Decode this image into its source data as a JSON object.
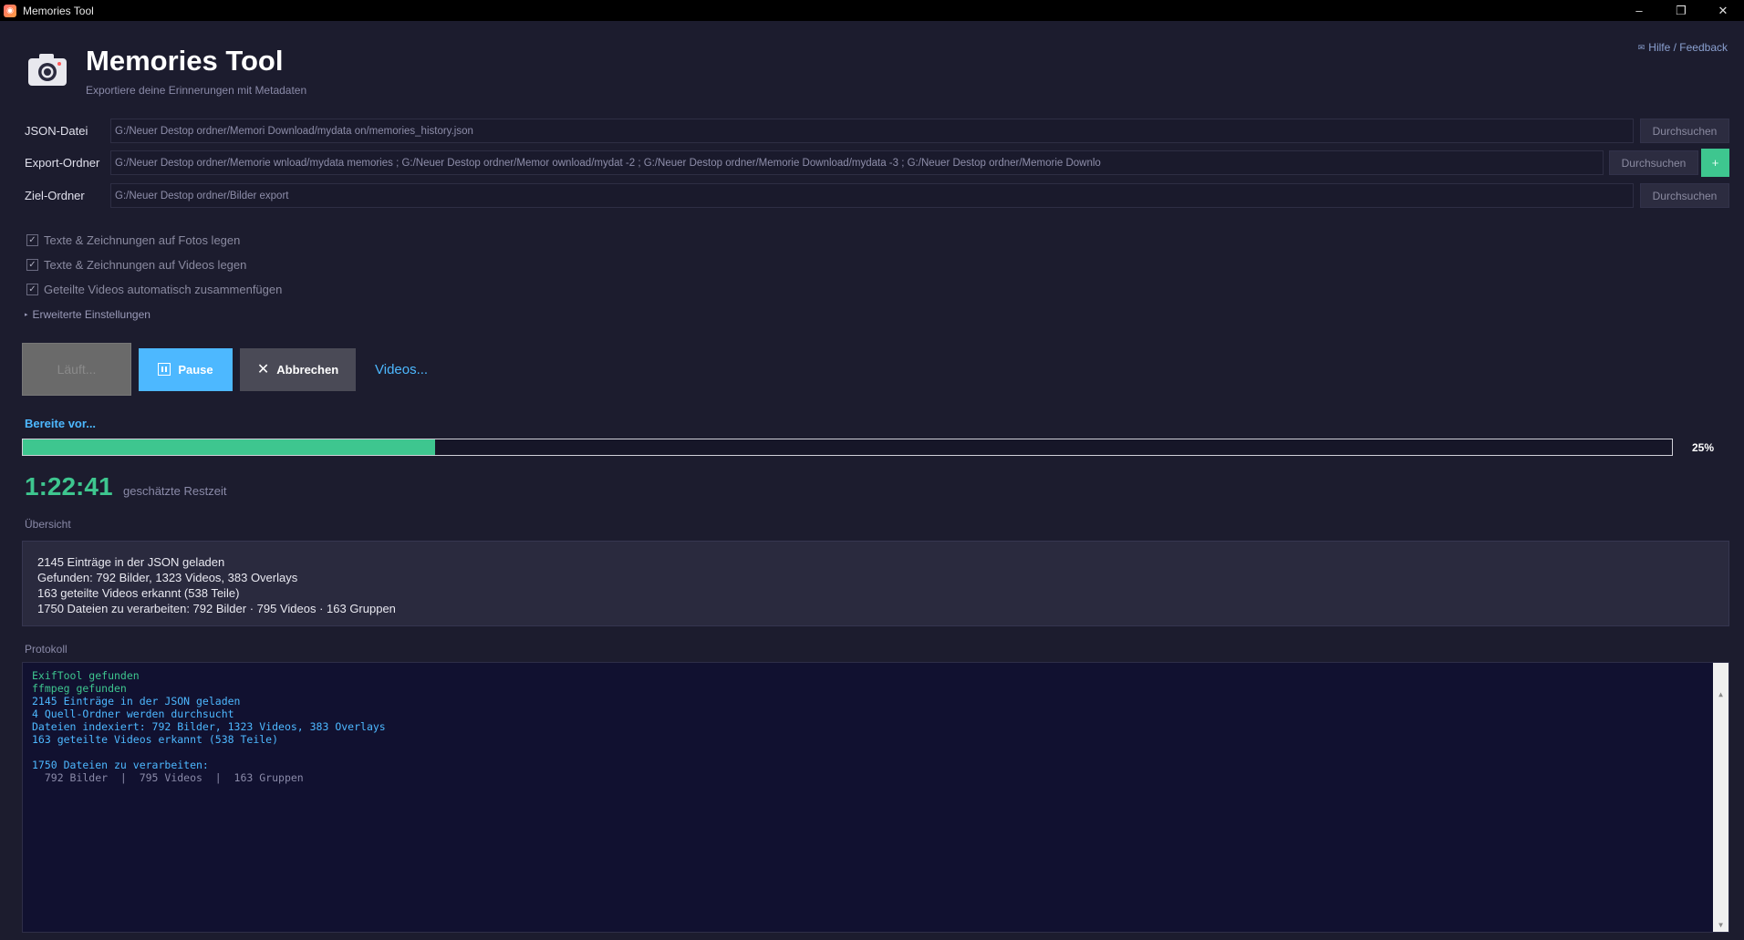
{
  "window": {
    "title": "Memories Tool",
    "controls": [
      "–",
      "❐",
      "✕"
    ]
  },
  "header": {
    "title": "Memories Tool",
    "subtitle": "Exportiere deine Erinnerungen mit Metadaten",
    "help": "Hilfe / Feedback"
  },
  "fields": {
    "json": {
      "label": "JSON-Datei",
      "value": "G:/Neuer Destop ordner/Memori                    Download/mydata                                  on/memories_history.json",
      "browse": "Durchsuchen"
    },
    "export": {
      "label": "Export-Ordner",
      "value": "G:/Neuer Destop ordner/Memorie                     wnload/mydata                                   memories ; G:/Neuer Destop ordner/Memor                   ownload/mydat                   -2 ; G:/Neuer Destop ordner/Memorie              Download/mydata                        -3 ; G:/Neuer Destop ordner/Memorie               Downlo",
      "browse": "Durchsuchen",
      "add": "+"
    },
    "target": {
      "label": "Ziel-Ordner",
      "value": "G:/Neuer Destop ordner/Bilder export",
      "browse": "Durchsuchen"
    }
  },
  "options": [
    {
      "label": "Texte & Zeichnungen auf Fotos legen",
      "checked": true
    },
    {
      "label": "Texte & Zeichnungen auf Videos legen",
      "checked": true
    },
    {
      "label": "Geteilte Videos automatisch zusammenfügen",
      "checked": true
    }
  ],
  "advanced": "Erweiterte Einstellungen",
  "actions": {
    "run": "Läuft...",
    "pause": "Pause",
    "cancel": "Abbrechen",
    "videos": "Videos..."
  },
  "progress": {
    "status": "Bereite vor...",
    "percent_label": "25%",
    "fraction": 0.25
  },
  "timer": {
    "value": "1:22:41",
    "label": "geschätzte Restzeit"
  },
  "overview": {
    "title": "Übersicht",
    "lines": [
      "2145 Einträge in der JSON geladen",
      "Gefunden: 792 Bilder, 1323 Videos, 383 Overlays",
      "163 geteilte Videos erkannt (538 Teile)",
      "1750 Dateien zu verarbeiten:  792 Bilder · 795 Videos · 163 Gruppen"
    ]
  },
  "log": {
    "title": "Protokoll",
    "lines": [
      {
        "text": "ExifTool gefunden",
        "color": "#3ec68f"
      },
      {
        "text": "ffmpeg gefunden",
        "color": "#3ec68f"
      },
      {
        "text": "2145 Einträge in der JSON geladen",
        "color": "#4db8ff"
      },
      {
        "text": "4 Quell-Ordner werden durchsucht",
        "color": "#4db8ff"
      },
      {
        "text": "Dateien indexiert: 792 Bilder, 1323 Videos, 383 Overlays",
        "color": "#4db8ff"
      },
      {
        "text": "163 geteilte Videos erkannt (538 Teile)",
        "color": "#4db8ff"
      },
      {
        "text": " ",
        "color": "#4db8ff"
      },
      {
        "text": "1750 Dateien zu verarbeiten:",
        "color": "#4db8ff"
      },
      {
        "text": "  792 Bilder  |  795 Videos  |  163 Gruppen",
        "color": "#8a8aa8"
      }
    ]
  },
  "colors": {
    "accent_blue": "#4db8ff",
    "accent_green": "#3ec68f",
    "background": "#1c1c2e"
  },
  "icons": {
    "app": "camera-icon",
    "help": "mail-icon",
    "pause": "pause-icon",
    "cancel": "close-icon",
    "advanced": "triangle-right-icon"
  }
}
